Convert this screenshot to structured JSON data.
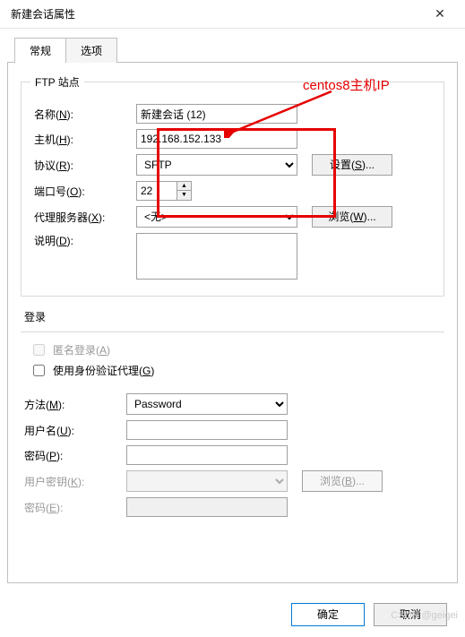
{
  "window": {
    "title": "新建会话属性",
    "close": "✕"
  },
  "tabs": {
    "general": "常规",
    "options": "选项"
  },
  "ftp": {
    "legend": "FTP 站点",
    "name_label": "名称(N):",
    "name_value": "新建会话 (12)",
    "host_label": "主机(H):",
    "host_value": "192.168.152.133",
    "protocol_label": "协议(R):",
    "protocol_value": "SFTP",
    "settings_btn": "设置(S)...",
    "port_label": "端口号(O):",
    "port_value": "22",
    "proxy_label": "代理服务器(X):",
    "proxy_value": "<无>",
    "browse_btn": "浏览(W)...",
    "desc_label": "说明(D):",
    "desc_value": ""
  },
  "login": {
    "legend": "登录",
    "anon_label": "匿名登录(A)",
    "ident_agent_label": "使用身份验证代理(G)",
    "method_label": "方法(M):",
    "method_value": "Password",
    "user_label": "用户名(U):",
    "user_value": "",
    "pass_label": "密码(P):",
    "pass_value": "",
    "userkey_label": "用户密钥(K):",
    "browsekey_btn": "浏览(B)...",
    "keypass_label": "密码(E):"
  },
  "footer": {
    "ok": "确定",
    "cancel": "取消"
  },
  "annotation": "centos8主机IP",
  "watermark": "CSDN @geigei"
}
